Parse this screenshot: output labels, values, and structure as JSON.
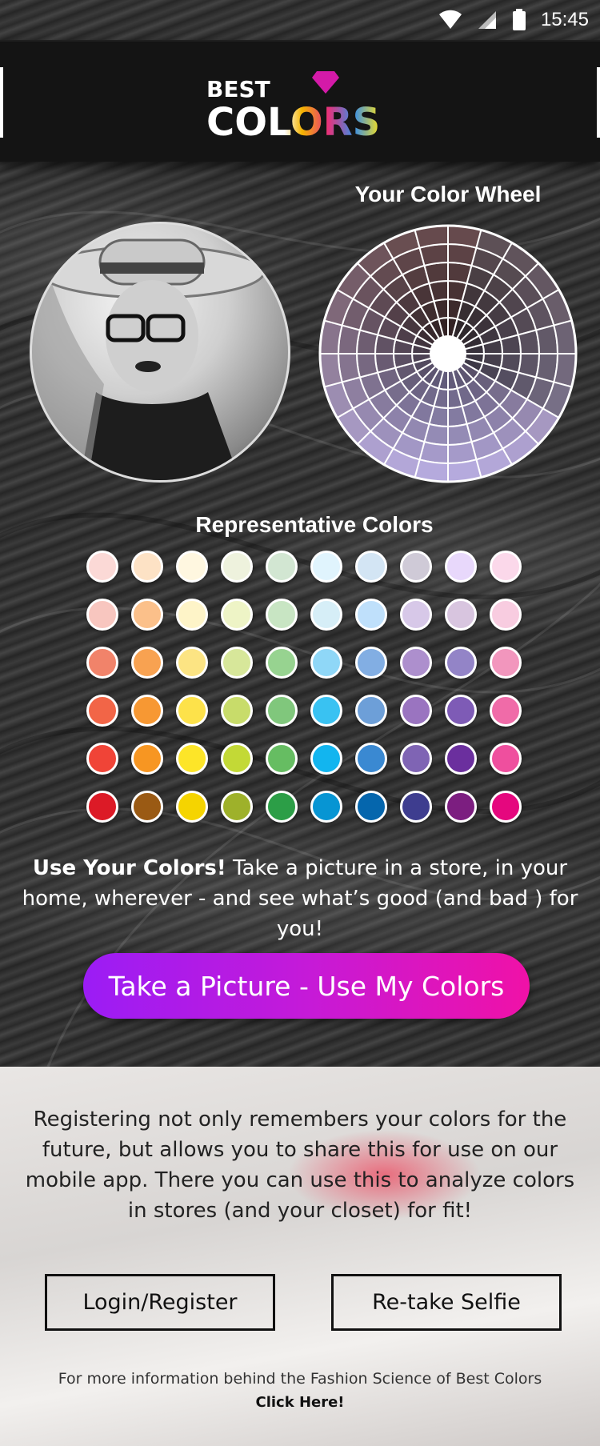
{
  "status_bar": {
    "time": "15:45"
  },
  "header": {
    "logo_top": "BEST",
    "logo_bottom": "COLORS"
  },
  "selfie": {
    "alt": "user selfie"
  },
  "color_wheel": {
    "title": "Your Color Wheel"
  },
  "representative": {
    "title": "Representative Colors",
    "rows": [
      [
        "#fbd9d6",
        "#fde2c5",
        "#fff7e0",
        "#eef2dd",
        "#d2e6d2",
        "#e0f4fd",
        "#d3e5f4",
        "#cfcad7",
        "#e8d8fb",
        "#fbd8ea"
      ],
      [
        "#f8c6bf",
        "#fbc08a",
        "#fef4c8",
        "#eef4c6",
        "#c8e5c3",
        "#d6eef7",
        "#bfe0fb",
        "#d7c8e8",
        "#d8c5df",
        "#f8cce0"
      ],
      [
        "#f1836a",
        "#f8a251",
        "#fce483",
        "#d7e79a",
        "#97d390",
        "#8fd7f7",
        "#82aee3",
        "#ad8fcd",
        "#9384c7",
        "#f296bd"
      ],
      [
        "#f26547",
        "#f79833",
        "#fde24a",
        "#c8dc6a",
        "#80c77c",
        "#39c2f2",
        "#6d9fd8",
        "#9a74c0",
        "#7e5bb6",
        "#f06ba8"
      ],
      [
        "#f04437",
        "#f79622",
        "#fde528",
        "#c3d936",
        "#66bd62",
        "#12b5ef",
        "#3a89d2",
        "#7f64b4",
        "#6b2f9e",
        "#ef4f9e"
      ],
      [
        "#dc1a26",
        "#9a5a14",
        "#f5d400",
        "#9eb12a",
        "#2c9e47",
        "#0795d3",
        "#0566ad",
        "#3e3d8f",
        "#7c1e80",
        "#e5077e"
      ]
    ]
  },
  "use_colors": {
    "bold": "Use Your Colors!",
    "text": " Take a picture in a store, in your home, wherever - and see what’s good (and bad ) for you!"
  },
  "cta_label": "Take a Picture - Use My Colors",
  "register_text": "Registering not only remembers your colors for the future, but allows you to share this for use on our mobile app. There you can use this to analyze colors in stores (and your closet) for fit!",
  "buttons": {
    "login": "Login/Register",
    "retake": "Re-take Selfie"
  },
  "footer": {
    "info": "For more information behind the Fashion Science of Best Colors",
    "link": "Click Here!"
  },
  "colors": {
    "accent_start": "#9b1cf5",
    "accent_end": "#f011a7"
  }
}
